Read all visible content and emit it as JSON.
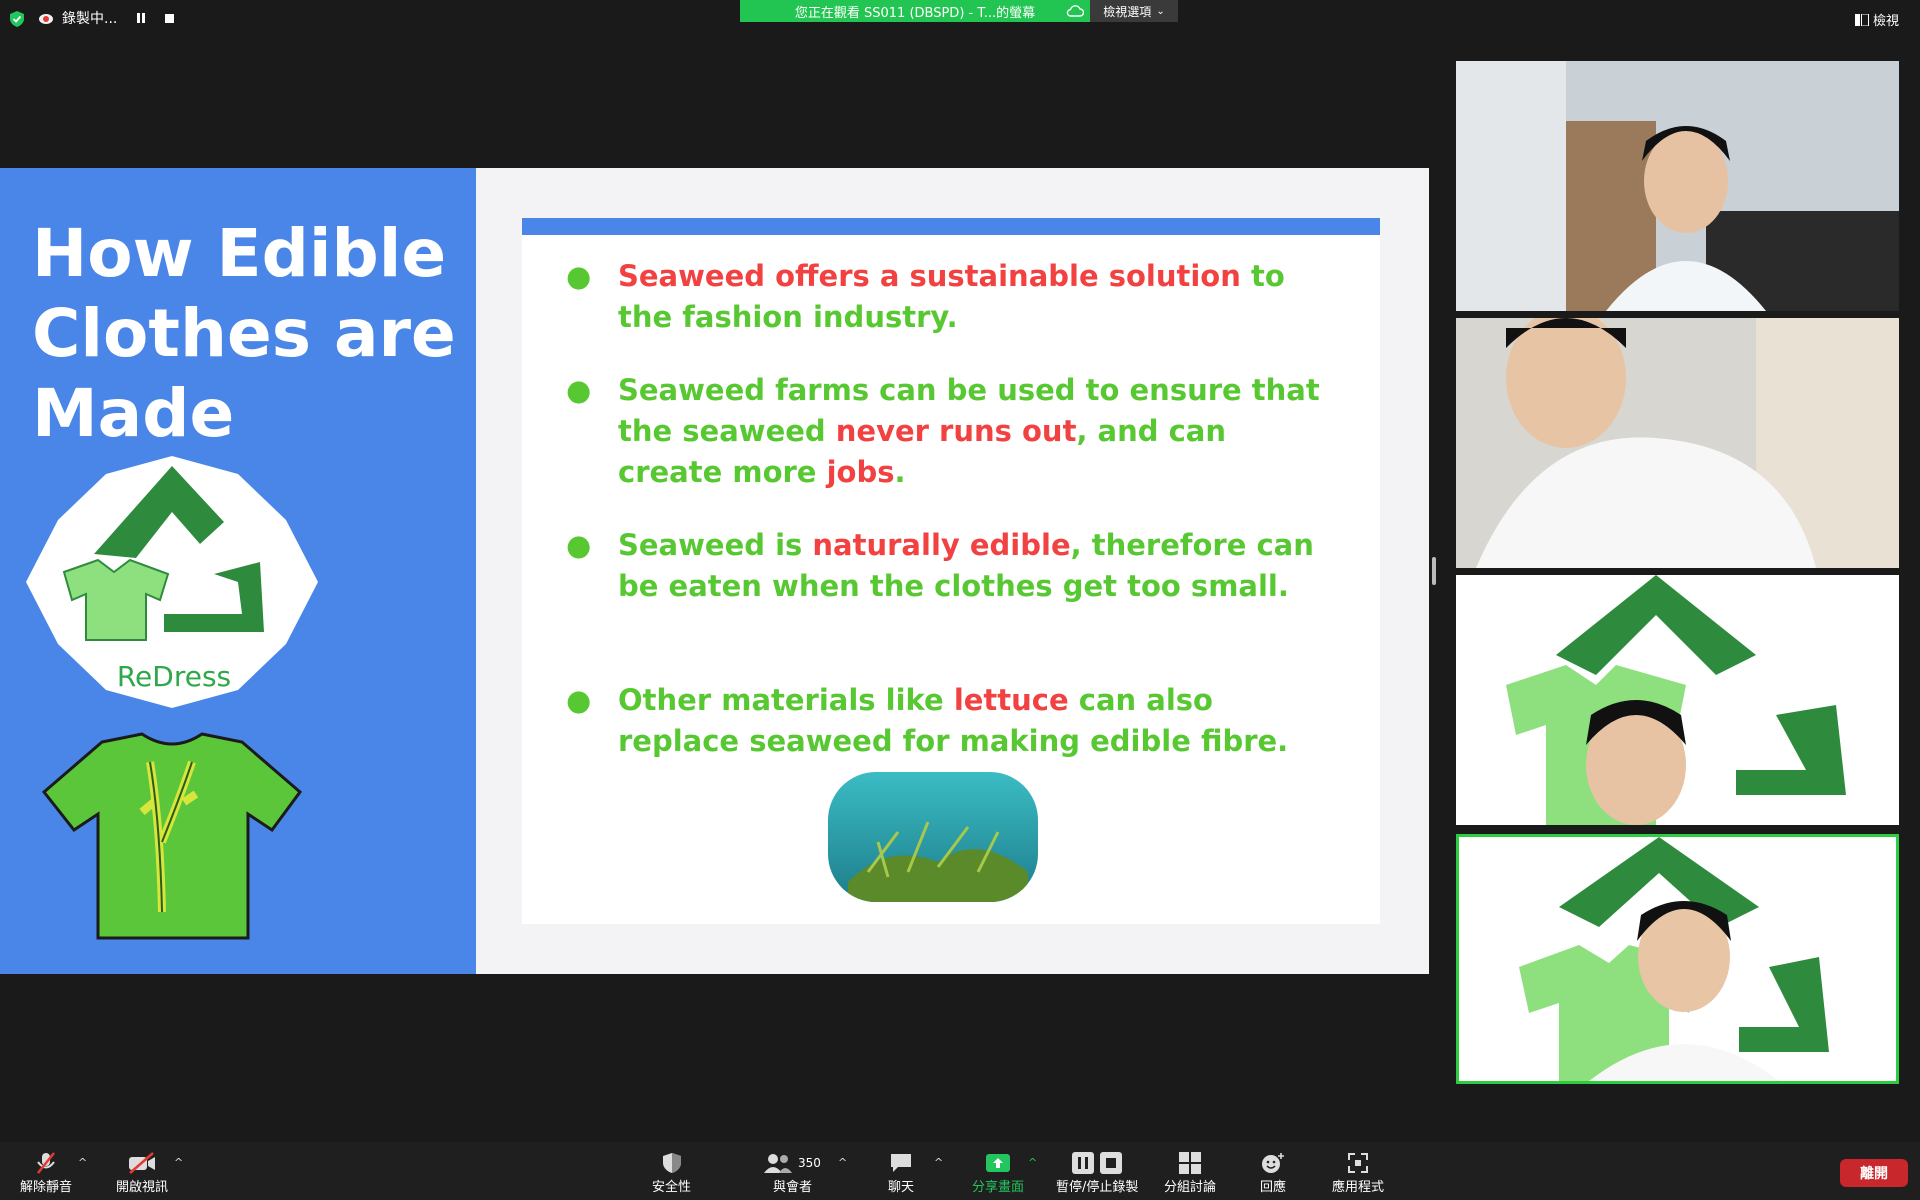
{
  "topbar": {
    "recording_label": "錄製中...",
    "share_banner": "您正在觀看 SS011 (DBSPD) - T...的螢幕",
    "view_options": "檢視選項",
    "view_label": "檢視"
  },
  "slide": {
    "title": "How Edible Clothes are Made",
    "logo_text": "ReDress",
    "bullets": [
      {
        "parts": [
          {
            "t": "Seaweed offers a ",
            "red": true
          },
          {
            "t": "",
            "red": false
          }
        ]
      },
      {},
      {},
      {}
    ],
    "b1_r1": "Seaweed offers a sustainable solution",
    "b1_g1": " to the fashion industry.",
    "b2_g1": "Seaweed farms can be used to ensure that the seaweed ",
    "b2_r1": "never runs out",
    "b2_g2": ", and can create more ",
    "b2_r2": "jobs",
    "b2_g3": ".",
    "b3_g1": "Seaweed is ",
    "b3_r1": "naturally edible",
    "b3_g2": ", therefore can be eaten when the clothes get too small.",
    "b4_g1": "Other materials like ",
    "b4_r1": "lettuce",
    "b4_g2": " can also replace seaweed for making edible fibre.",
    "bullet_dot": "●"
  },
  "toolbar": {
    "unmute": "解除靜音",
    "start_video": "開啟視訊",
    "security": "安全性",
    "participants": "與會者",
    "participants_count": "350",
    "chat": "聊天",
    "share_screen": "分享畫面",
    "pause_stop_recording": "暫停/停止錄製",
    "breakout": "分組討論",
    "reactions": "回應",
    "apps": "應用程式",
    "leave": "離開"
  },
  "colors": {
    "slide_blue": "#4a86e8",
    "text_green": "#58c832",
    "text_red": "#f24141",
    "share_green": "#23c552",
    "active_border": "#2ecc40",
    "leave_red": "#c8272c"
  }
}
